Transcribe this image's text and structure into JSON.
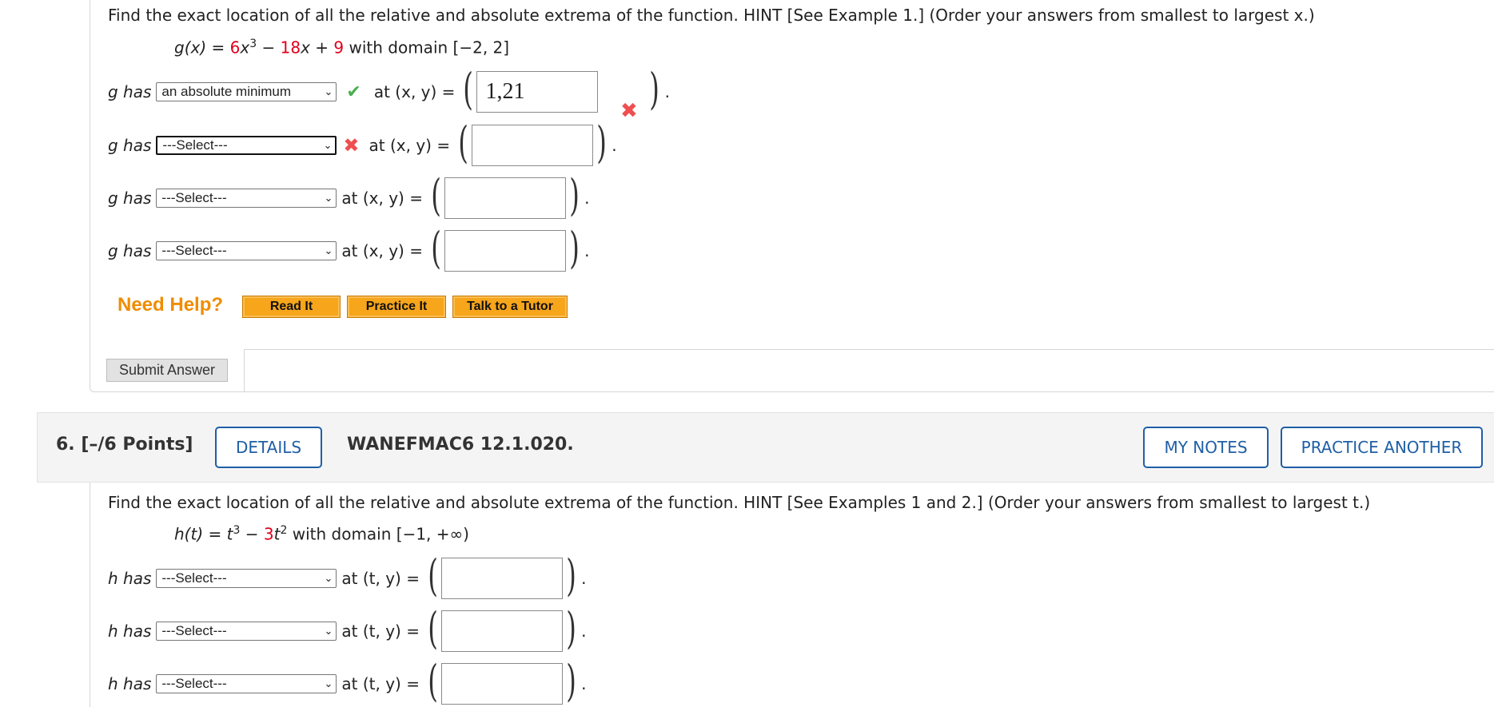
{
  "q5": {
    "prompt": "Find the exact location of all the relative and absolute extrema of the function. HINT [See Example 1.] (Order your answers from smallest to largest x.)",
    "function": {
      "name": "g(x) =",
      "c1": "6",
      "x3": "x",
      "e1": "3",
      "minus": " − ",
      "c2": "18",
      "x": "x",
      "plus": " + ",
      "c3": "9",
      "domain": " with domain [−2, 2]"
    },
    "rows": [
      {
        "lead": "g has",
        "select": "an absolute minimum",
        "at": "at (x, y) =",
        "value": "1,21"
      },
      {
        "lead": "g has",
        "select": "---Select---",
        "at": "at (x, y) =",
        "value": ""
      },
      {
        "lead": "g has",
        "select": "---Select---",
        "at": "at (x, y) =",
        "value": ""
      },
      {
        "lead": "g has",
        "select": "---Select---",
        "at": "at (x, y) =",
        "value": ""
      }
    ],
    "help": {
      "label": "Need Help?",
      "read": "Read It",
      "practice": "Practice It",
      "tutor": "Talk to a Tutor"
    },
    "submit": "Submit Answer"
  },
  "q6": {
    "number": "6.  [–/6 Points]",
    "details": "DETAILS",
    "code": "WANEFMAC6 12.1.020.",
    "notes": "MY NOTES",
    "practice_another": "PRACTICE ANOTHER",
    "prompt": "Find the exact location of all the relative and absolute extrema of the function. HINT [See Examples 1 and 2.] (Order your answers from smallest to largest t.)",
    "function": {
      "name": "h(t) =",
      "t1": "t",
      "e1": "3",
      "minus": " − ",
      "c1": "3",
      "t2": "t",
      "e2": "2",
      "domain": " with domain [−1, +∞)"
    },
    "rows": [
      {
        "lead": "h has",
        "select": "---Select---",
        "at": "at (t, y) =",
        "value": ""
      },
      {
        "lead": "h has",
        "select": "---Select---",
        "at": "at (t, y) =",
        "value": ""
      },
      {
        "lead": "h has",
        "select": "---Select---",
        "at": "at (t, y) =",
        "value": ""
      }
    ]
  },
  "colors": {
    "accent_blue": "#1f5fa6",
    "help_orange": "#f08c00",
    "coef_red": "#e0001b",
    "correct_green": "#4caf50",
    "wrong_red": "#ef4f4f"
  }
}
